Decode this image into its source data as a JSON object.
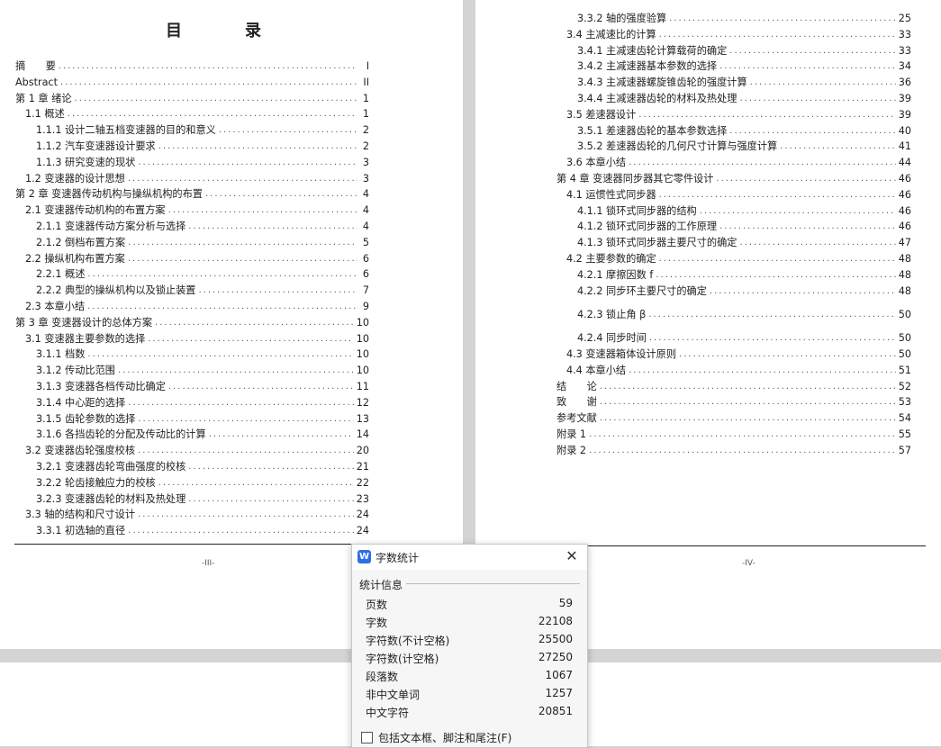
{
  "document": {
    "toc_title": "目　录",
    "left_page": {
      "page_label": "-III-",
      "entries": [
        {
          "label": "摘　　要",
          "page": "I"
        },
        {
          "label": "Abstract",
          "page": "II"
        },
        {
          "label": "第 1 章  绪论",
          "page": "1"
        },
        {
          "label": "1.1  概述",
          "page": "1"
        },
        {
          "label": "1.1.1  设计二轴五档变速器的目的和意义",
          "page": "2"
        },
        {
          "label": "1.1.2  汽车变速器设计要求",
          "page": "2"
        },
        {
          "label": "1.1.3  研究变速的现状",
          "page": "3"
        },
        {
          "label": "1.2  变速器的设计思想",
          "page": "3"
        },
        {
          "label": "第 2 章  变速器传动机构与操纵机构的布置",
          "page": "4"
        },
        {
          "label": "2.1  变速器传动机构的布置方案",
          "page": "4"
        },
        {
          "label": "2.1.1  变速器传动方案分析与选择",
          "page": "4"
        },
        {
          "label": "2.1.2  倒档布置方案",
          "page": "5"
        },
        {
          "label": "2.2  操纵机构布置方案",
          "page": "6"
        },
        {
          "label": "2.2.1  概述",
          "page": "6"
        },
        {
          "label": "2.2.2  典型的操纵机构以及锁止装置",
          "page": "7"
        },
        {
          "label": "2.3  本章小结",
          "page": "9"
        },
        {
          "label": "第 3 章  变速器设计的总体方案",
          "page": "10"
        },
        {
          "label": "3.1  变速器主要参数的选择",
          "page": "10"
        },
        {
          "label": "3.1.1  档数",
          "page": "10"
        },
        {
          "label": "3.1.2  传动比范围",
          "page": "10"
        },
        {
          "label": "3.1.3  变速器各档传动比确定",
          "page": "11"
        },
        {
          "label": "3.1.4  中心距的选择",
          "page": "12"
        },
        {
          "label": "3.1.5  齿轮参数的选择",
          "page": "13"
        },
        {
          "label": "3.1.6  各挡齿轮的分配及传动比的计算",
          "page": "14"
        },
        {
          "label": "3.2  变速器齿轮强度校核",
          "page": "20"
        },
        {
          "label": "3.2.1  变速器齿轮弯曲强度的校核",
          "page": "21"
        },
        {
          "label": "3.2.2  轮齿接触应力的校核",
          "page": "22"
        },
        {
          "label": "3.2.3  变速器齿轮的材料及热处理",
          "page": "23"
        },
        {
          "label": "3.3  轴的结构和尺寸设计",
          "page": "24"
        },
        {
          "label": "3.3.1  初选轴的直径",
          "page": "24"
        }
      ]
    },
    "right_page": {
      "page_label": "-IV-",
      "entries": [
        {
          "label": "3.3.2  轴的强度验算",
          "page": "25"
        },
        {
          "label": "3.4  主减速比的计算",
          "page": "33"
        },
        {
          "label": "3.4.1  主减速齿轮计算载荷的确定",
          "page": "33"
        },
        {
          "label": "3.4.2  主减速器基本参数的选择",
          "page": "34"
        },
        {
          "label": "3.4.3  主减速器螺旋锥齿轮的强度计算",
          "page": "36"
        },
        {
          "label": "3.4.4  主减速器齿轮的材料及热处理",
          "page": "39"
        },
        {
          "label": "3.5  差速器设计",
          "page": "39"
        },
        {
          "label": "3.5.1  差速器齿轮的基本参数选择",
          "page": "40"
        },
        {
          "label": "3.5.2  差速器齿轮的几何尺寸计算与强度计算",
          "page": "41"
        },
        {
          "label": "3.6  本章小结",
          "page": "44"
        },
        {
          "label": "第 4 章  变速器同步器其它零件设计",
          "page": "46"
        },
        {
          "label": "4.1  运惯性式同步器",
          "page": "46"
        },
        {
          "label": "4.1.1  锁环式同步器的结构",
          "page": "46"
        },
        {
          "label": "4.1.2  锁环式同步器的工作原理",
          "page": "46"
        },
        {
          "label": "4.1.3  锁环式同步器主要尺寸的确定",
          "page": "47"
        },
        {
          "label": "4.2  主要参数的确定",
          "page": "48"
        },
        {
          "label": "4.2.1  摩擦因数 f",
          "page": "48"
        },
        {
          "label": "4.2.2  同步环主要尺寸的确定",
          "page": "48"
        },
        {
          "label": "4.2.3  锁止角 β",
          "page": "50"
        },
        {
          "label": "4.2.4  同步时间",
          "page": "50"
        },
        {
          "label": "4.3  变速器箱体设计原则",
          "page": "50"
        },
        {
          "label": "4.4  本章小结",
          "page": "51"
        },
        {
          "label": "结　　论",
          "page": "52"
        },
        {
          "label": "致　　谢",
          "page": "53"
        },
        {
          "label": "参考文献",
          "page": "54"
        },
        {
          "label": "附录 1",
          "page": "55"
        },
        {
          "label": "附录 2",
          "page": "57"
        }
      ]
    }
  },
  "dialog": {
    "icon_text": "W",
    "title": "字数统计",
    "close_glyph": "✕",
    "section_label": "统计信息",
    "stats": [
      {
        "label": "页数",
        "value": "59"
      },
      {
        "label": "字数",
        "value": "22108"
      },
      {
        "label": "字符数(不计空格)",
        "value": "25500"
      },
      {
        "label": "字符数(计空格)",
        "value": "27250"
      },
      {
        "label": "段落数",
        "value": "1067"
      },
      {
        "label": "非中文单词",
        "value": "1257"
      },
      {
        "label": "中文字符",
        "value": "20851"
      }
    ],
    "include_label": "包括文本框、脚注和尾注(F)",
    "include_checked": false
  }
}
